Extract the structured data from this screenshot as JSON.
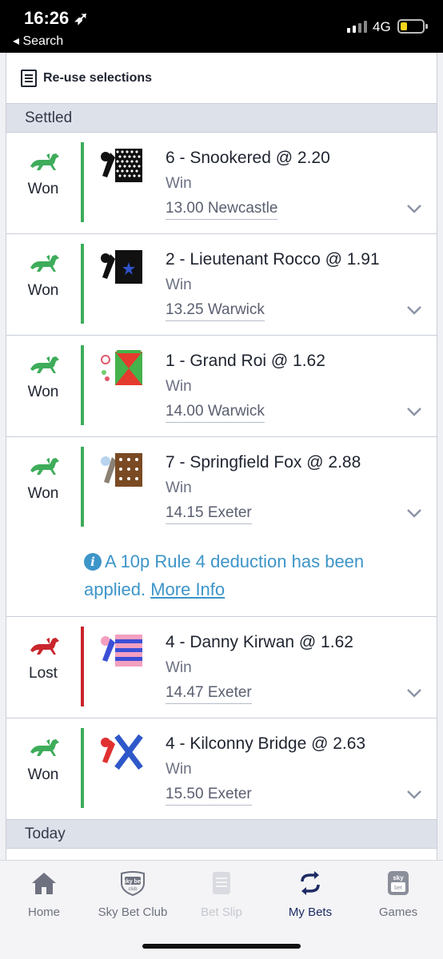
{
  "status_bar": {
    "time": "16:26 ➶",
    "back_label": "◂ Search",
    "network": "4G"
  },
  "reuse": {
    "label": "Re-use selections"
  },
  "sections": {
    "settled": "Settled",
    "today": "Today"
  },
  "colors": {
    "won": "#3eac5a",
    "lost": "#c9262c",
    "accent": "#3d95c9",
    "active_tab": "#1e2b64"
  },
  "bets": [
    {
      "result": "Won",
      "selection": "6 - Snookered @ 2.20",
      "market": "Win",
      "race": "13.00 Newcastle",
      "silk": "black-white-diamonds-silk"
    },
    {
      "result": "Won",
      "selection": "2 - Lieutenant Rocco @ 1.91",
      "market": "Win",
      "race": "13.25 Warwick",
      "silk": "black-blue-star-silk"
    },
    {
      "result": "Won",
      "selection": "1 - Grand Roi @ 1.62",
      "market": "Win",
      "race": "14.00 Warwick",
      "silk": "red-green-quartered-silk"
    },
    {
      "result": "Won",
      "selection": "7 - Springfield Fox @ 2.88",
      "market": "Win",
      "race": "14.15 Exeter",
      "silk": "brown-spots-silk",
      "info_text": "A 10p Rule 4 deduction has been applied.",
      "info_link": "More Info"
    },
    {
      "result": "Lost",
      "selection": "4 - Danny Kirwan @ 1.62",
      "market": "Win",
      "race": "14.47 Exeter",
      "silk": "pink-blue-hoops-silk"
    },
    {
      "result": "Won",
      "selection": "4 - Kilconny Bridge @ 2.63",
      "market": "Win",
      "race": "15.50 Exeter",
      "silk": "white-blue-cross-silk"
    }
  ],
  "tabs": [
    {
      "label": "Home",
      "icon": "home-icon",
      "state": "normal"
    },
    {
      "label": "Sky Bet Club",
      "icon": "sky-bet-club-icon",
      "state": "normal"
    },
    {
      "label": "Bet Slip",
      "icon": "bet-slip-icon",
      "state": "disabled"
    },
    {
      "label": "My Bets",
      "icon": "my-bets-icon",
      "state": "active"
    },
    {
      "label": "Games",
      "icon": "sky-bet-games-icon",
      "state": "normal"
    }
  ]
}
